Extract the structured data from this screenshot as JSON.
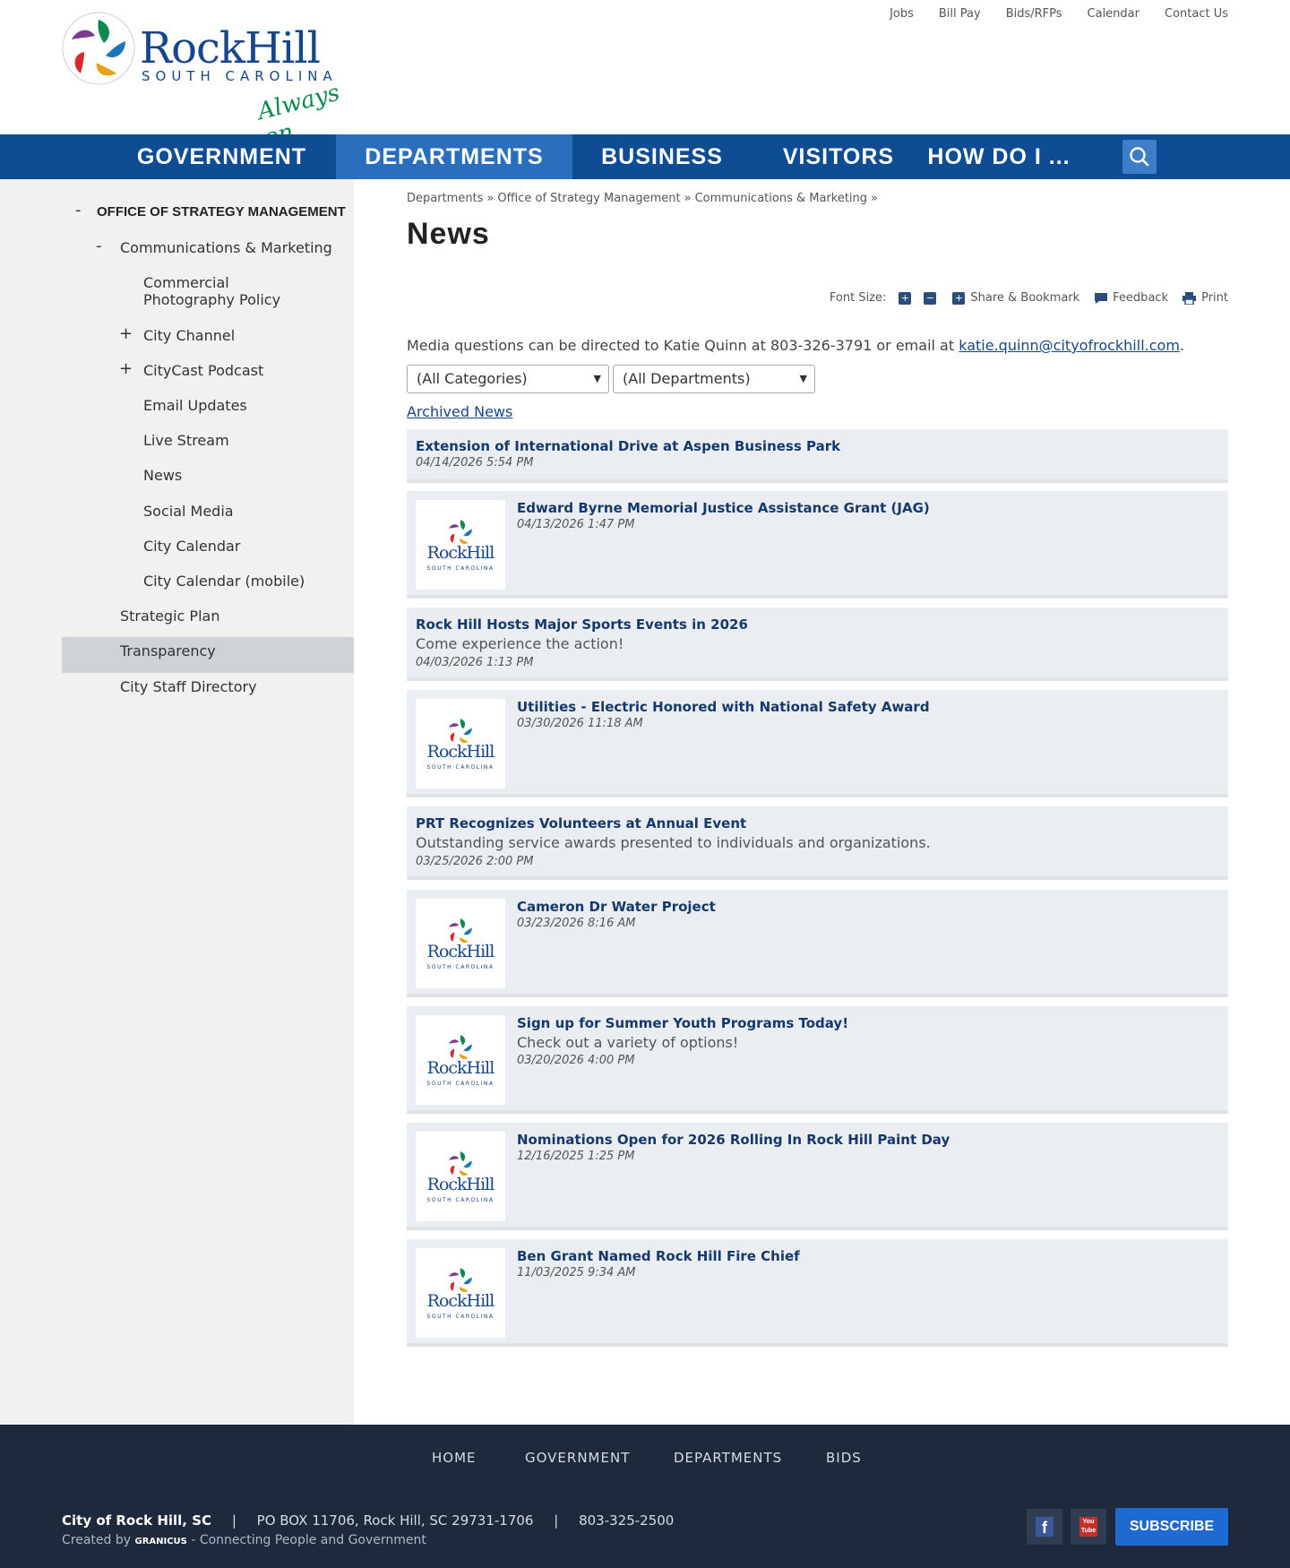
{
  "header": {
    "logo_text_main": "RockHill",
    "logo_text_sub": "SOUTH CAROLINA",
    "logo_tagline": "Always on.",
    "utility_nav": [
      "Jobs",
      "Bill Pay",
      "Bids/RFPs",
      "Calendar",
      "Contact Us"
    ]
  },
  "main_nav": {
    "items": [
      "GOVERNMENT",
      "DEPARTMENTS",
      "BUSINESS",
      "VISITORS",
      "HOW DO I ..."
    ],
    "active": "DEPARTMENTS",
    "search_icon": "search-icon"
  },
  "sidebar": {
    "title": "OFFICE OF STRATEGY MANAGEMENT",
    "title_sign": "-",
    "section": "Communications & Marketing",
    "section_sign": "-",
    "items": [
      {
        "label": "Commercial Photography Policy",
        "sign": ""
      },
      {
        "label": "City Channel",
        "sign": "+"
      },
      {
        "label": "CityCast Podcast",
        "sign": "+"
      },
      {
        "label": "Email Updates",
        "sign": ""
      },
      {
        "label": "Live Stream",
        "sign": ""
      },
      {
        "label": "News",
        "sign": "",
        "active": true
      },
      {
        "label": "Social Media",
        "sign": ""
      },
      {
        "label": "City Calendar",
        "sign": ""
      },
      {
        "label": "City Calendar (mobile)",
        "sign": ""
      }
    ],
    "siblings": [
      "Strategic Plan",
      "Transparency",
      "City Staff Directory"
    ]
  },
  "breadcrumb": [
    "Departments",
    "Office of Strategy Management",
    "Communications & Marketing"
  ],
  "breadcrumb_sep": "»",
  "page_title": "News",
  "tools": {
    "font_size_label": "Font Size:",
    "plus": "+",
    "minus": "−",
    "share": "Share & Bookmark",
    "feedback": "Feedback",
    "print": "Print"
  },
  "media": {
    "text": "Media questions can be directed to Katie Quinn at 803-326-3791 or email at ",
    "email": "katie.quinn@cityofrockhill.com",
    "end": "."
  },
  "filters": {
    "categories": "(All Categories)",
    "departments": "(All Departments)"
  },
  "archived_label": "Archived News",
  "thumb": {
    "main": "RockHill",
    "sub": "SOUTH CAROLINA"
  },
  "news": [
    {
      "title": "Extension of International Drive at Aspen Business Park",
      "date": "04/14/2026 5:54 PM",
      "desc": "",
      "thumb": false
    },
    {
      "title": "Edward Byrne Memorial Justice Assistance Grant (JAG)",
      "date": "04/13/2026 1:47 PM",
      "desc": "",
      "thumb": true
    },
    {
      "title": "Rock Hill Hosts Major Sports Events in 2026",
      "date": "04/03/2026 1:13 PM",
      "desc": "Come experience the action!",
      "thumb": false
    },
    {
      "title": "Utilities - Electric Honored with National Safety Award",
      "date": "03/30/2026 11:18 AM",
      "desc": "",
      "thumb": true
    },
    {
      "title": "PRT Recognizes Volunteers at Annual Event",
      "date": "03/25/2026 2:00 PM",
      "desc": "Outstanding service awards presented to individuals and organizations.",
      "thumb": false
    },
    {
      "title": "Cameron Dr Water Project",
      "date": "03/23/2026 8:16 AM",
      "desc": "",
      "thumb": true
    },
    {
      "title": "Sign up for Summer Youth Programs Today!",
      "date": "03/20/2026 4:00 PM",
      "desc": "Check out a variety of options!",
      "thumb": true
    },
    {
      "title": "Nominations Open for 2026 Rolling In Rock Hill Paint Day",
      "date": "12/16/2025 1:25 PM",
      "desc": "",
      "thumb": true
    },
    {
      "title": "Ben Grant Named Rock Hill Fire Chief",
      "date": "11/03/2025 9:34 AM",
      "desc": "",
      "thumb": true
    }
  ],
  "footer": {
    "nav": [
      "HOME",
      "GOVERNMENT",
      "DEPARTMENTS",
      "BIDS"
    ],
    "city": "City of Rock Hill, SC",
    "sep": "|",
    "address": "PO BOX 11706, Rock Hill, SC 29731-1706",
    "phone": "803-325-2500",
    "credit_prefix": "Created by ",
    "credit_brand": "GRANICUS",
    "credit_suffix": " - Connecting People and Government",
    "subscribe": "SUBSCRIBE",
    "facebook_icon": "f",
    "youtube_icon": "You Tube"
  },
  "colors": {
    "nav_bg": "#0e4c94",
    "nav_active": "#2a6fbe",
    "link": "#15396c",
    "footer_bg": "#1e2a3b",
    "subscribe": "#1e6ad0"
  }
}
